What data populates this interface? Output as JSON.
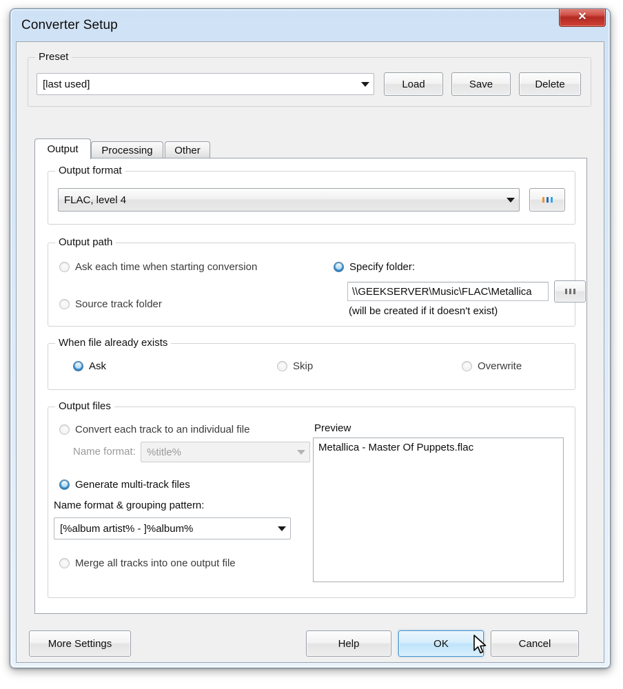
{
  "window": {
    "title": "Converter Setup",
    "close_label": "✕",
    "accent_blue": "#3c8fcc",
    "close_red": "#b22b22"
  },
  "preset": {
    "group_title": "Preset",
    "combo_value": "[last used]",
    "buttons": [
      {
        "label": "Load",
        "name": "load-preset-button"
      },
      {
        "label": "Save",
        "name": "save-preset-button"
      },
      {
        "label": "Delete",
        "name": "delete-preset-button"
      }
    ]
  },
  "tabs": [
    {
      "label": "Output",
      "active": true
    },
    {
      "label": "Processing",
      "active": false
    },
    {
      "label": "Other",
      "active": false
    }
  ],
  "output_format": {
    "group_title": "Output format",
    "value": "FLAC, level 4",
    "browse_label": "..."
  },
  "output_path": {
    "group_title": "Output path",
    "options": [
      {
        "label": "Ask each time when starting conversion",
        "checked": false
      },
      {
        "label": "Source track folder",
        "checked": false
      },
      {
        "label": "Specify folder:",
        "checked": true
      }
    ],
    "folder_value": "\\\\GEEKSERVER\\Music\\FLAC\\Metallica",
    "browse_label": "...",
    "hint": "(will be created if it doesn't exist)"
  },
  "when_exists": {
    "group_title": "When file already exists",
    "options": [
      {
        "label": "Ask",
        "checked": true
      },
      {
        "label": "Skip",
        "checked": false
      },
      {
        "label": "Overwrite",
        "checked": false
      }
    ]
  },
  "output_files": {
    "group_title": "Output files",
    "option_individual": {
      "label": "Convert each track to an individual file",
      "checked": false
    },
    "name_format_label": "Name format:",
    "name_format_value": "%title%",
    "option_multitrack": {
      "label": "Generate multi-track files",
      "checked": true
    },
    "grouping_label": "Name format & grouping pattern:",
    "grouping_value": "[%album artist% - ]%album%",
    "option_merge": {
      "label": "Merge all tracks into one output file",
      "checked": false
    },
    "preview_label": "Preview",
    "preview_items": [
      "Metallica - Master Of Puppets.flac"
    ]
  },
  "footer": {
    "more_settings": "More Settings",
    "help": "Help",
    "ok": "OK",
    "cancel": "Cancel"
  }
}
